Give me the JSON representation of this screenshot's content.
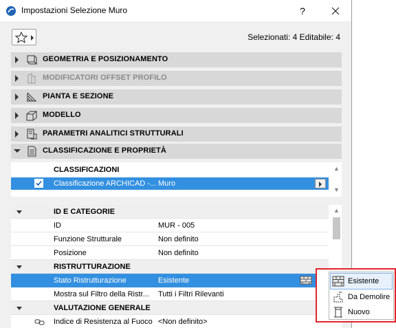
{
  "window": {
    "title": "Impostazioni Selezione Muro",
    "help_label": "?",
    "selection_info": "Selezionati: 4 Editabile: 4"
  },
  "panels": [
    {
      "label": "GEOMETRIA E POSIZIONAMENTO",
      "icon": "geometry-icon",
      "expanded": false,
      "disabled": false
    },
    {
      "label": "MODIFICATORI OFFSET PROFILO",
      "icon": "profile-offset-icon",
      "expanded": false,
      "disabled": true
    },
    {
      "label": "PIANTA E SEZIONE",
      "icon": "floor-plan-icon",
      "expanded": false,
      "disabled": false
    },
    {
      "label": "MODELLO",
      "icon": "model-icon",
      "expanded": false,
      "disabled": false
    },
    {
      "label": "PARAMETRI ANALITICI STRUTTURALI",
      "icon": "structural-icon",
      "expanded": false,
      "disabled": false
    },
    {
      "label": "CLASSIFICAZIONE E PROPRIETÀ",
      "icon": "classification-icon",
      "expanded": true,
      "disabled": false
    }
  ],
  "classifications": {
    "header": "CLASSIFICAZIONI",
    "row": {
      "name": "Classificazione ARCHICAD -...",
      "value": "Muro",
      "checked": true
    }
  },
  "properties": {
    "groups": [
      {
        "label": "ID E CATEGORIE",
        "rows": [
          {
            "label": "ID",
            "value": "MUR - 005"
          },
          {
            "label": "Funzione Strutturale",
            "value": "Non definito"
          },
          {
            "label": "Posizione",
            "value": "Non definito"
          }
        ]
      },
      {
        "label": "RISTRUTTURAZIONE",
        "rows": [
          {
            "label": "Stato Ristrutturazione",
            "value": "Esistente",
            "selected": true
          },
          {
            "label": "Mostra sul Filtro della Ristr...",
            "value": "Tutti i Filtri Rilevanti"
          }
        ]
      },
      {
        "label": "VALUTAZIONE GENERALE",
        "rows": [
          {
            "label": "Indice di Resistenza al Fuoco",
            "value": "<Non definito>"
          }
        ]
      }
    ]
  },
  "renovation_menu": {
    "items": [
      {
        "label": "Esistente",
        "icon": "existing-wall-icon",
        "highlighted": true
      },
      {
        "label": "Da Demolire",
        "icon": "demolish-icon",
        "highlighted": false
      },
      {
        "label": "Nuovo",
        "icon": "new-construction-icon",
        "highlighted": false
      }
    ]
  },
  "colors": {
    "selection": "#3390e0",
    "callout_border": "#e0232a",
    "panel_header": "#d8d8d8"
  }
}
